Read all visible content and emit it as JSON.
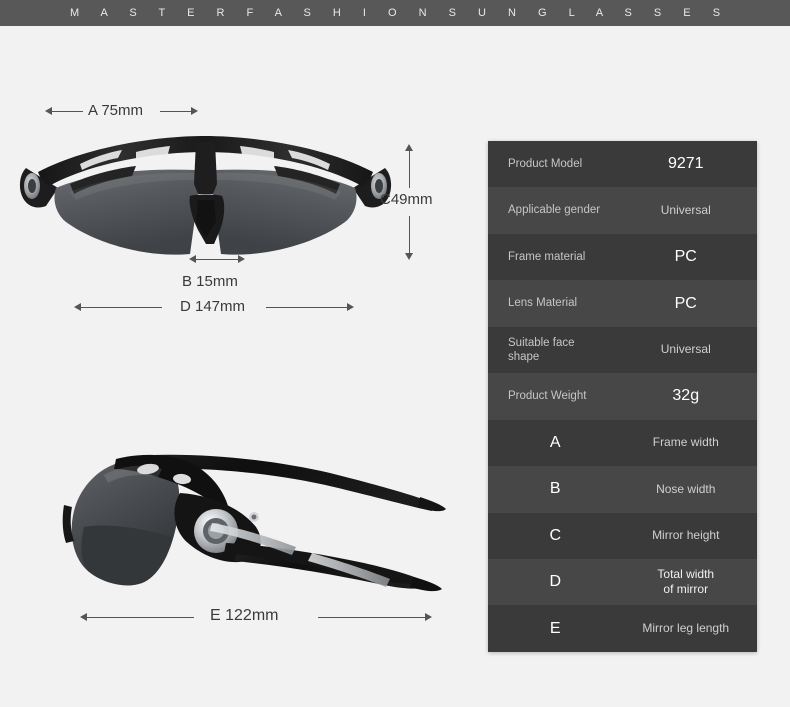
{
  "banner": {
    "text": "M A S T E R   F A S H I O N   S U N G L A S S E S"
  },
  "dimensions": {
    "a": "A 75mm",
    "b": "B 15mm",
    "c": "C49mm",
    "d": "D 147mm",
    "e": "E 122mm"
  },
  "spec_table": {
    "rows": [
      {
        "key": "Product Model",
        "value": "9271",
        "value_style": "big"
      },
      {
        "key": "Applicable gender",
        "value": "Universal",
        "value_style": "muted"
      },
      {
        "key": "Frame material",
        "value": "PC",
        "value_style": "big"
      },
      {
        "key": "Lens Material",
        "value": "PC",
        "value_style": "big"
      },
      {
        "key": "Suitable face\nshape",
        "value": "Universal",
        "value_style": "muted"
      },
      {
        "key": "Product Weight",
        "value": "32g",
        "value_style": "big"
      },
      {
        "key": "A",
        "value": "Frame width",
        "value_style": "muted"
      },
      {
        "key": "B",
        "value": "Nose width",
        "value_style": "muted"
      },
      {
        "key": "C",
        "value": "Mirror height",
        "value_style": "muted"
      },
      {
        "key": "D",
        "value": "Total width\nof mirror",
        "value_style": "normal"
      },
      {
        "key": "E",
        "value": "Mirror leg length",
        "value_style": "muted"
      }
    ]
  },
  "colors": {
    "banner_bg": "#585858",
    "page_bg": "#f2f2f2",
    "row_odd": "#3a3a3a",
    "row_even": "#474747",
    "frame_black": "#1b1b1b",
    "lens_gray": "#55575a",
    "chrome": "#cfd2d6"
  }
}
